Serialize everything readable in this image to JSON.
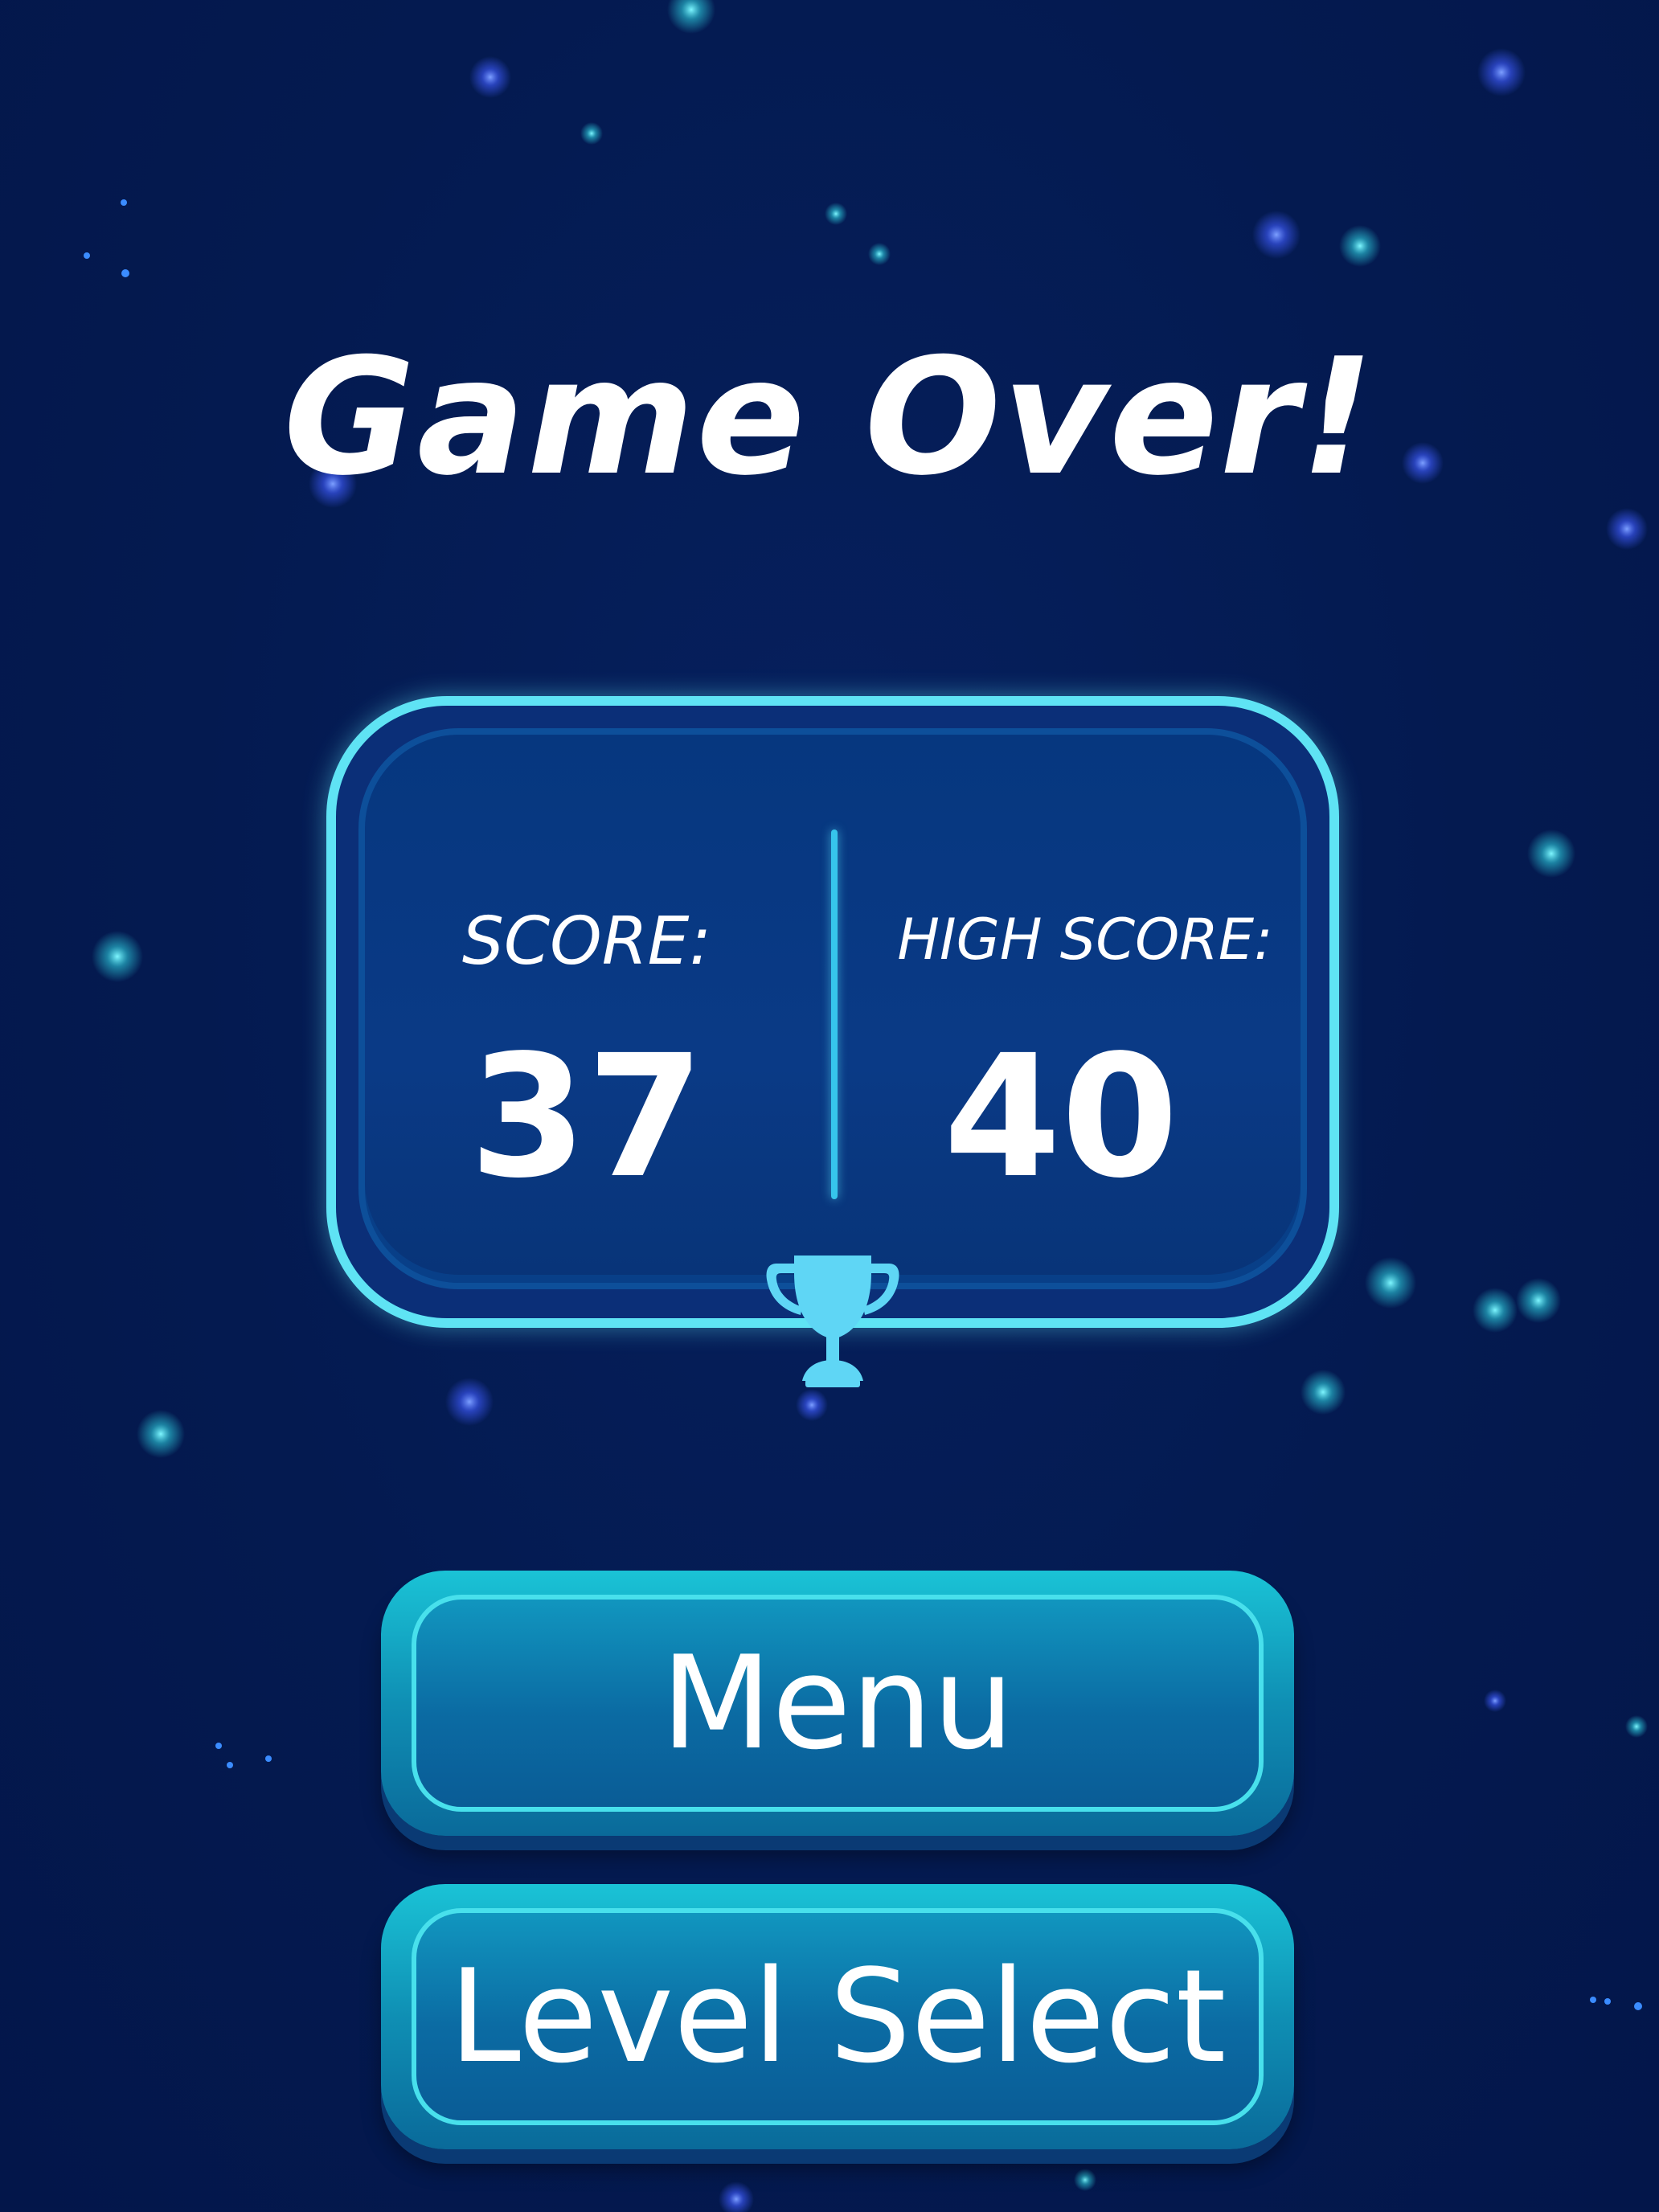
{
  "screen": {
    "title": "Game Over!"
  },
  "stats": {
    "score_label": "SCORE:",
    "score_value": "37",
    "high_score_label": "HIGH SCORE:",
    "high_score_value": "40"
  },
  "buttons": {
    "menu_label": "Menu",
    "level_select_label": "Level Select"
  },
  "icons": {
    "trophy": "trophy-icon"
  },
  "colors": {
    "background": "#041b52",
    "panel_border": "#5fe3f4",
    "panel_fill": "#0a3a86",
    "button_top": "#1ac3d6",
    "button_bottom": "#0a6a9a",
    "trophy": "#5fd6f5",
    "text": "#ffffff"
  }
}
